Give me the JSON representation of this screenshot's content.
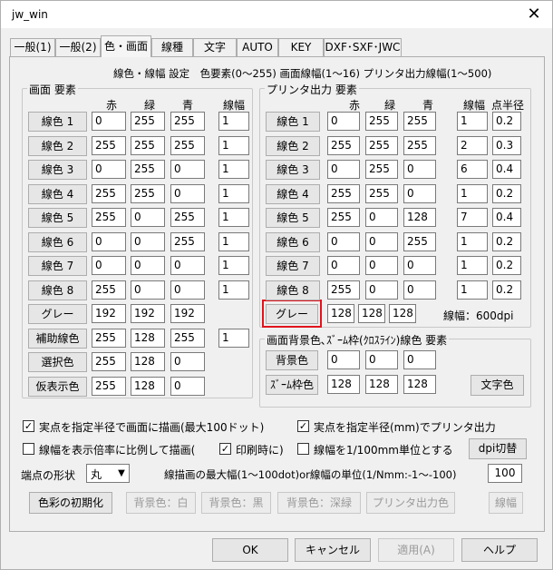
{
  "window": {
    "title": "jw_win",
    "close": "✕"
  },
  "tabs": [
    "一般(1)",
    "一般(2)",
    "色・画面",
    "線種",
    "文字",
    "AUTO",
    "KEY",
    "DXF･SXF･JWC"
  ],
  "header_text": "線色・線幅 設定　色要素(0〜255) 画面線幅(1〜16)  プリンタ出力線幅(1〜500)",
  "screen_group": {
    "label": "画面 要素",
    "col_red": "赤",
    "col_green": "緑",
    "col_blue": "青",
    "col_width": "線幅",
    "rows": [
      {
        "label": "線色 1",
        "r": "0",
        "g": "255",
        "b": "255",
        "w": "1"
      },
      {
        "label": "線色 2",
        "r": "255",
        "g": "255",
        "b": "255",
        "w": "1"
      },
      {
        "label": "線色 3",
        "r": "0",
        "g": "255",
        "b": "0",
        "w": "1"
      },
      {
        "label": "線色 4",
        "r": "255",
        "g": "255",
        "b": "0",
        "w": "1"
      },
      {
        "label": "線色 5",
        "r": "255",
        "g": "0",
        "b": "255",
        "w": "1"
      },
      {
        "label": "線色 6",
        "r": "0",
        "g": "0",
        "b": "255",
        "w": "1"
      },
      {
        "label": "線色 7",
        "r": "0",
        "g": "0",
        "b": "0",
        "w": "1"
      },
      {
        "label": "線色 8",
        "r": "255",
        "g": "0",
        "b": "0",
        "w": "1"
      }
    ],
    "gray": {
      "label": "グレー",
      "r": "192",
      "g": "192",
      "b": "192"
    },
    "aux": {
      "label": "補助線色",
      "r": "255",
      "g": "128",
      "b": "255",
      "w": "1"
    },
    "select": {
      "label": "選択色",
      "r": "255",
      "g": "128",
      "b": "0"
    },
    "temp": {
      "label": "仮表示色",
      "r": "255",
      "g": "128",
      "b": "0"
    }
  },
  "printer_group": {
    "label": "プリンタ出力 要素",
    "col_red": "赤",
    "col_green": "緑",
    "col_blue": "青",
    "col_width": "線幅",
    "col_radius": "点半径",
    "rows": [
      {
        "label": "線色 1",
        "r": "0",
        "g": "255",
        "b": "255",
        "w": "1",
        "p": "0.2"
      },
      {
        "label": "線色 2",
        "r": "255",
        "g": "255",
        "b": "255",
        "w": "2",
        "p": "0.3"
      },
      {
        "label": "線色 3",
        "r": "0",
        "g": "255",
        "b": "0",
        "w": "6",
        "p": "0.4"
      },
      {
        "label": "線色 4",
        "r": "255",
        "g": "255",
        "b": "0",
        "w": "1",
        "p": "0.2"
      },
      {
        "label": "線色 5",
        "r": "255",
        "g": "0",
        "b": "128",
        "w": "7",
        "p": "0.4"
      },
      {
        "label": "線色 6",
        "r": "0",
        "g": "0",
        "b": "255",
        "w": "1",
        "p": "0.2"
      },
      {
        "label": "線色 7",
        "r": "0",
        "g": "0",
        "b": "0",
        "w": "1",
        "p": "0.2"
      },
      {
        "label": "線色 8",
        "r": "255",
        "g": "0",
        "b": "0",
        "w": "1",
        "p": "0.2"
      }
    ],
    "gray": {
      "label": "グレー",
      "r": "128",
      "g": "128",
      "b": "128"
    },
    "dpi_text": "線幅：600dpi"
  },
  "background_group": {
    "label": "画面背景色､ｽﾞｰﾑ枠(ｸﾛｽﾗｲﾝ)線色 要素",
    "bg": {
      "label": "背景色",
      "r": "0",
      "g": "0",
      "b": "0"
    },
    "zoom": {
      "label": "ｽﾞｰﾑ枠色",
      "r": "128",
      "g": "128",
      "b": "128"
    },
    "text_color_button": "文字色"
  },
  "options": {
    "real_point_screen": {
      "label": "実点を指定半径で画面に描画(最大100ドット)",
      "checked": true
    },
    "real_point_printer": {
      "label": "実点を指定半径(mm)でプリンタ出力",
      "checked": true
    },
    "scale_width": {
      "label": "線幅を表示倍率に比例して描画(",
      "checked": false
    },
    "on_print": {
      "label": "印刷時に)",
      "checked": true
    },
    "width_unit": {
      "label": "線幅を1/100mm単位とする",
      "checked": false
    },
    "dpi_switch": "dpi切替"
  },
  "endpoint": {
    "label": "端点の形状",
    "value": "丸",
    "max_width_label": "線描画の最大幅(1〜100dot)or線幅の単位(1/Nmm:-1〜-100)",
    "max_width_value": "100"
  },
  "bottom_buttons": {
    "init": "色彩の初期化",
    "bg_white": "背景色：白",
    "bg_black": "背景色：黒",
    "bg_dark": "背景色：深緑",
    "printer_color": "プリンタ出力色",
    "width": "線幅"
  },
  "dialog_buttons": {
    "ok": "OK",
    "cancel": "キャンセル",
    "apply": "適用(A)",
    "help": "ヘルプ"
  }
}
